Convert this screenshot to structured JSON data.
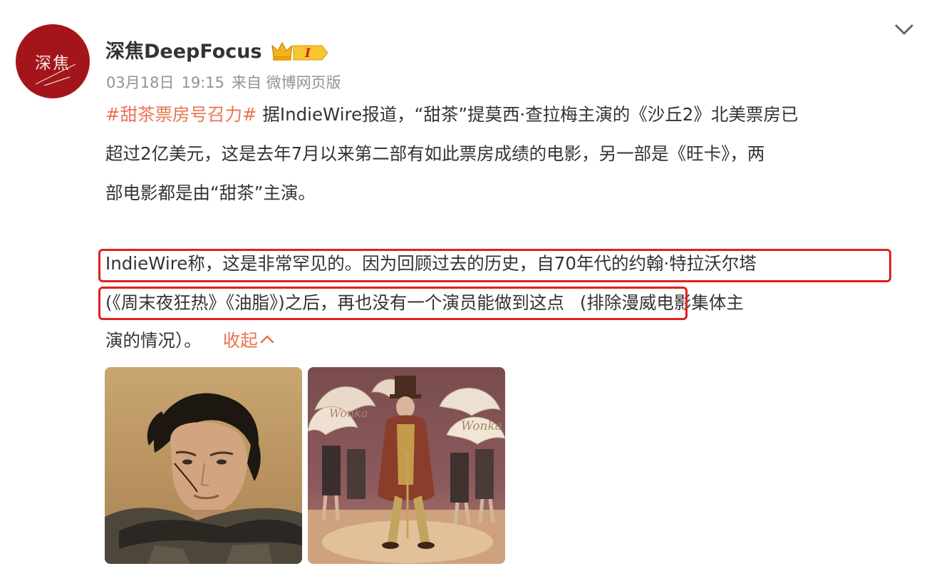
{
  "author": {
    "avatar_text": "深焦",
    "name": "深焦DeepFocus",
    "badge_level": "I"
  },
  "post": {
    "date": "03月18日",
    "time": "19:15",
    "source": "来自 微博网页版",
    "hashtag": "#甜茶票房号召力#",
    "line1_rest": " 据IndieWire报道，“甜茶”提莫西·查拉梅主演的《沙丘2》北美票房已",
    "line2": "超过2亿美元，这是去年7月以来第二部有如此票房成绩的电影，另一部是《旺卡》，两",
    "line3": "部电影都是由“甜茶”主演。",
    "line4": "IndieWire称，这是非常罕见的。因为回顾过去的历史，自70年代的约翰·特拉沃尔塔",
    "line5_highlighted": "(《周末夜狂热》《油脂》)之后，再也没有一个演员能做到这点",
    "line5_rest": "(排除漫威电影集体主",
    "line6": "演的情况）。",
    "collapse_label": "收起"
  },
  "images": [
    {
      "icon": "dune-2-still"
    },
    {
      "icon": "wonka-still"
    }
  ],
  "colors": {
    "accent": "#eb7350",
    "highlight_border": "#e0211d",
    "avatar_bg": "#a4151b"
  }
}
